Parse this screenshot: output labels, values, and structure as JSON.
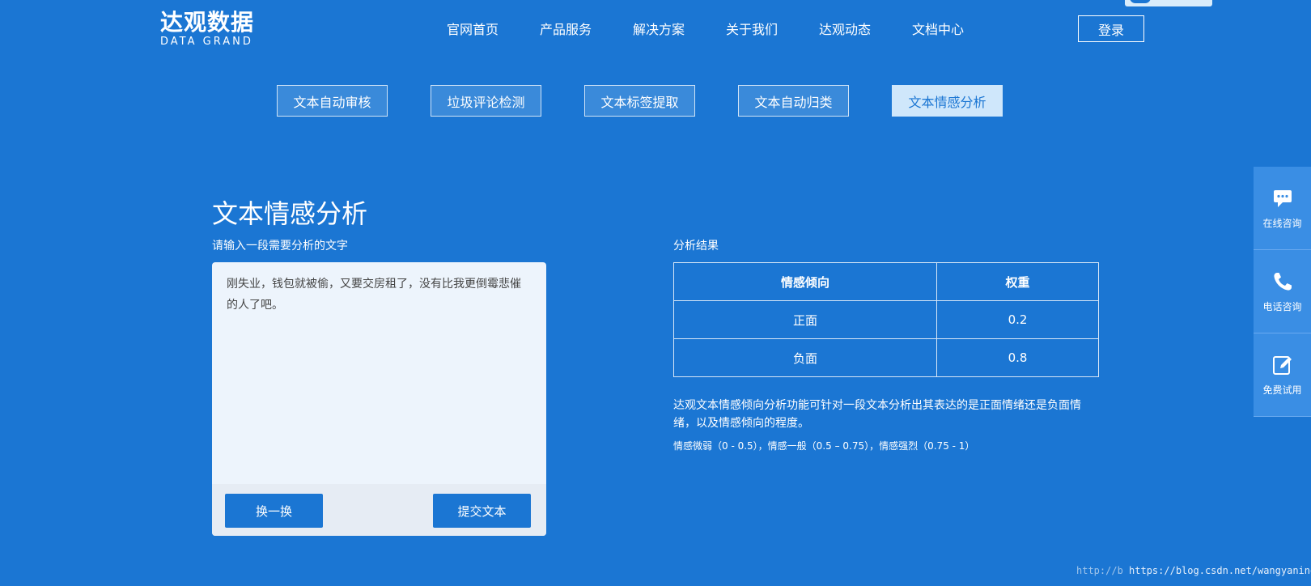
{
  "logo": {
    "cn": "达观数据",
    "en": "DATA GRAND"
  },
  "nav": {
    "items": [
      "官网首页",
      "产品服务",
      "解决方案",
      "关于我们",
      "达观动态",
      "文档中心"
    ],
    "login": "登录"
  },
  "tabs": {
    "items": [
      "文本自动审核",
      "垃圾评论检测",
      "文本标签提取",
      "文本自动归类",
      "文本情感分析"
    ],
    "active_index": 4
  },
  "main": {
    "title": "文本情感分析",
    "input_label": "请输入一段需要分析的文字",
    "input_text": "刚失业，钱包就被偷，又要交房租了，没有比我更倒霉悲催的人了吧。",
    "swap_button": "换一换",
    "submit_button": "提交文本"
  },
  "result": {
    "label": "分析结果",
    "headers": [
      "情感倾向",
      "权重"
    ],
    "rows": [
      {
        "sentiment": "正面",
        "weight": "0.2"
      },
      {
        "sentiment": "负面",
        "weight": "0.8"
      }
    ],
    "description": "达观文本情感倾向分析功能可针对一段文本分析出其表达的是正面情绪还是负面情绪，以及情感倾向的程度。",
    "levels": "情感微弱（0 - 0.5），情感一般（0.5 – 0.75），情感强烈（0.75 - 1）"
  },
  "sidebar": {
    "items": [
      {
        "label": "在线咨询",
        "icon": "chat-icon"
      },
      {
        "label": "电话咨询",
        "icon": "phone-icon"
      },
      {
        "label": "免费试用",
        "icon": "edit-icon"
      }
    ]
  },
  "watermark": {
    "faint": "http://b",
    "url": "https://blog.csdn.net/wangyaninglm"
  },
  "colors": {
    "background": "#1b76d3",
    "active_tab_bg": "#cfe7fb",
    "input_bg": "#edf4fc"
  }
}
